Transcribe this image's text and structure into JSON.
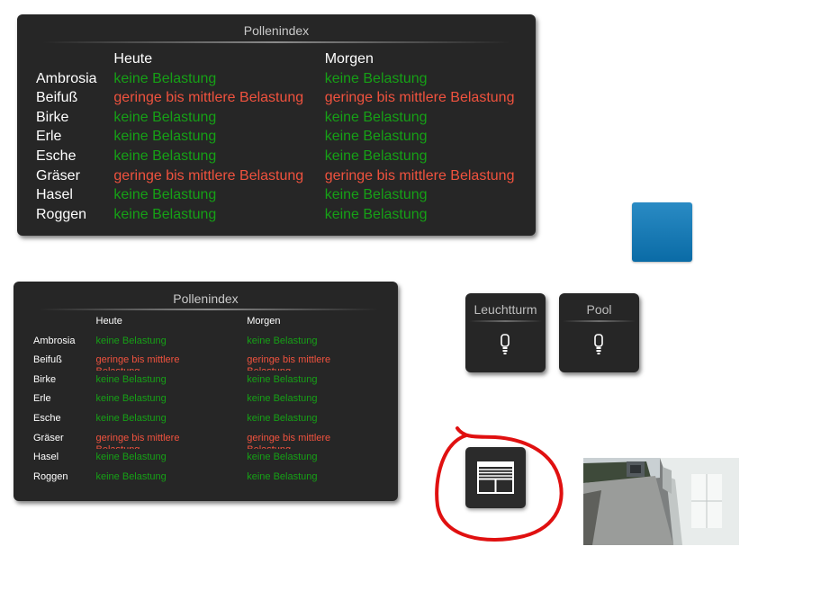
{
  "widget_large": {
    "title": "Pollenindex",
    "col_today": "Heute",
    "col_tomorrow": "Morgen",
    "rows": [
      {
        "plant": "Ambrosia",
        "today": "keine Belastung",
        "today_level": "none",
        "tomorrow": "keine Belastung",
        "tomorrow_level": "none"
      },
      {
        "plant": "Beifuß",
        "today": "geringe bis mittlere Belastung",
        "today_level": "low-medium",
        "tomorrow": "geringe bis mittlere Belastung",
        "tomorrow_level": "low-medium"
      },
      {
        "plant": "Birke",
        "today": "keine Belastung",
        "today_level": "none",
        "tomorrow": "keine Belastung",
        "tomorrow_level": "none"
      },
      {
        "plant": "Erle",
        "today": "keine Belastung",
        "today_level": "none",
        "tomorrow": "keine Belastung",
        "tomorrow_level": "none"
      },
      {
        "plant": "Esche",
        "today": "keine Belastung",
        "today_level": "none",
        "tomorrow": "keine Belastung",
        "tomorrow_level": "none"
      },
      {
        "plant": "Gräser",
        "today": "geringe bis mittlere Belastung",
        "today_level": "low-medium",
        "tomorrow": "geringe bis mittlere Belastung",
        "tomorrow_level": "low-medium"
      },
      {
        "plant": "Hasel",
        "today": "keine Belastung",
        "today_level": "none",
        "tomorrow": "keine Belastung",
        "tomorrow_level": "none"
      },
      {
        "plant": "Roggen",
        "today": "keine Belastung",
        "today_level": "none",
        "tomorrow": "keine Belastung",
        "tomorrow_level": "none"
      }
    ]
  },
  "widget_small": {
    "title": "Pollenindex",
    "col_today": "Heute",
    "col_tomorrow": "Morgen",
    "rows": [
      {
        "plant": "Ambrosia",
        "today": "keine Belastung",
        "today_level": "none",
        "tomorrow": "keine Belastung",
        "tomorrow_level": "none"
      },
      {
        "plant": "Beifuß",
        "today": "geringe bis mittlere Belastung",
        "today_level": "low-medium",
        "tomorrow": "geringe bis mittlere Belastung",
        "tomorrow_level": "low-medium"
      },
      {
        "plant": "Birke",
        "today": "keine Belastung",
        "today_level": "none",
        "tomorrow": "keine Belastung",
        "tomorrow_level": "none"
      },
      {
        "plant": "Erle",
        "today": "keine Belastung",
        "today_level": "none",
        "tomorrow": "keine Belastung",
        "tomorrow_level": "none"
      },
      {
        "plant": "Esche",
        "today": "keine Belastung",
        "today_level": "none",
        "tomorrow": "keine Belastung",
        "tomorrow_level": "none"
      },
      {
        "plant": "Gräser",
        "today": "geringe bis mittlere Belastung",
        "today_level": "low-medium",
        "tomorrow": "geringe bis mittlere Belastung",
        "tomorrow_level": "low-medium"
      },
      {
        "plant": "Hasel",
        "today": "keine Belastung",
        "today_level": "none",
        "tomorrow": "keine Belastung",
        "tomorrow_level": "none"
      },
      {
        "plant": "Roggen",
        "today": "keine Belastung",
        "today_level": "none",
        "tomorrow": "keine Belastung",
        "tomorrow_level": "none"
      }
    ]
  },
  "buttons": {
    "lamp1_label": "Leuchtturm",
    "lamp2_label": "Pool",
    "lamp_icon": "lightbulb-icon",
    "shutter_icon": "window-shutter-icon"
  },
  "colors": {
    "none": "#16a016",
    "low_medium": "#f0523e",
    "tile_blue": "#0a6ba6",
    "annotation_red": "#e01010"
  }
}
